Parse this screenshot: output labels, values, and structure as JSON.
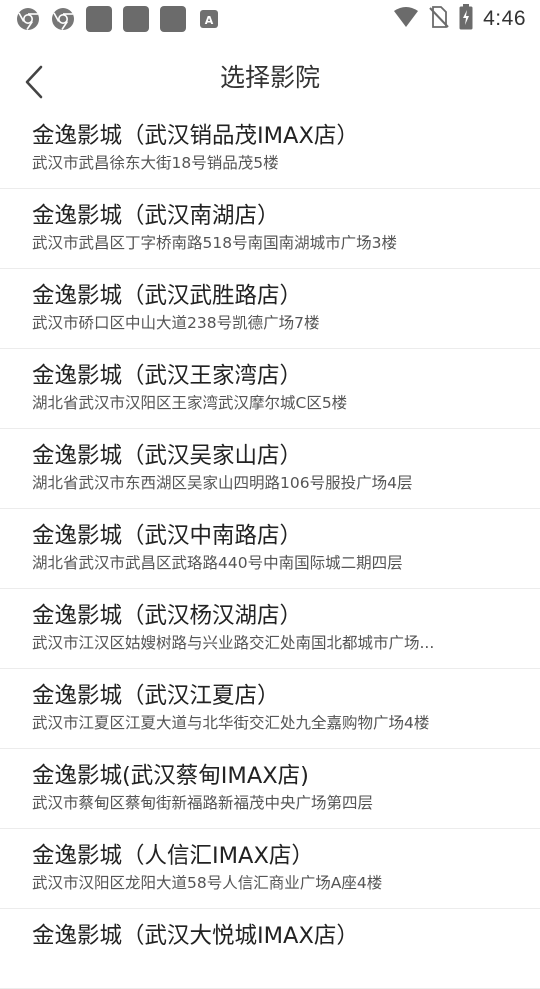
{
  "status_bar": {
    "time": "4:46",
    "notification_icons": [
      "chrome-icon",
      "chrome-icon",
      "app-icon",
      "app-icon",
      "app-icon",
      "font-app-icon"
    ],
    "font_icon_letter": "A",
    "system_icons": [
      "wifi-icon",
      "no-sim-icon",
      "battery-charging-icon"
    ]
  },
  "header": {
    "title": "选择影院",
    "back_icon": "chevron-left-icon"
  },
  "cinemas": [
    {
      "name": "金逸影城（武汉销品茂IMAX店）",
      "address": "武汉市武昌徐东大街18号销品茂5楼"
    },
    {
      "name": "金逸影城（武汉南湖店）",
      "address": "武汉市武昌区丁字桥南路518号南国南湖城市广场3楼"
    },
    {
      "name": "金逸影城（武汉武胜路店）",
      "address": "武汉市硚口区中山大道238号凯德广场7楼"
    },
    {
      "name": "金逸影城（武汉王家湾店）",
      "address": "湖北省武汉市汉阳区王家湾武汉摩尔城C区5楼"
    },
    {
      "name": "金逸影城（武汉吴家山店）",
      "address": "湖北省武汉市东西湖区吴家山四明路106号服投广场4层"
    },
    {
      "name": "金逸影城（武汉中南路店）",
      "address": "湖北省武汉市武昌区武珞路440号中南国际城二期四层"
    },
    {
      "name": "金逸影城（武汉杨汉湖店）",
      "address": "武汉市江汉区姑嫂树路与兴业路交汇处南国北都城市广场..."
    },
    {
      "name": "金逸影城（武汉江夏店）",
      "address": "武汉市江夏区江夏大道与北华街交汇处九全嘉购物广场4楼"
    },
    {
      "name": "金逸影城(武汉蔡甸IMAX店)",
      "address": "武汉市蔡甸区蔡甸街新福路新福茂中央广场第四层"
    },
    {
      "name": "金逸影城（人信汇IMAX店）",
      "address": "武汉市汉阳区龙阳大道58号人信汇商业广场A座4楼"
    },
    {
      "name": "金逸影城（武汉大悦城IMAX店）",
      "address": ""
    }
  ]
}
